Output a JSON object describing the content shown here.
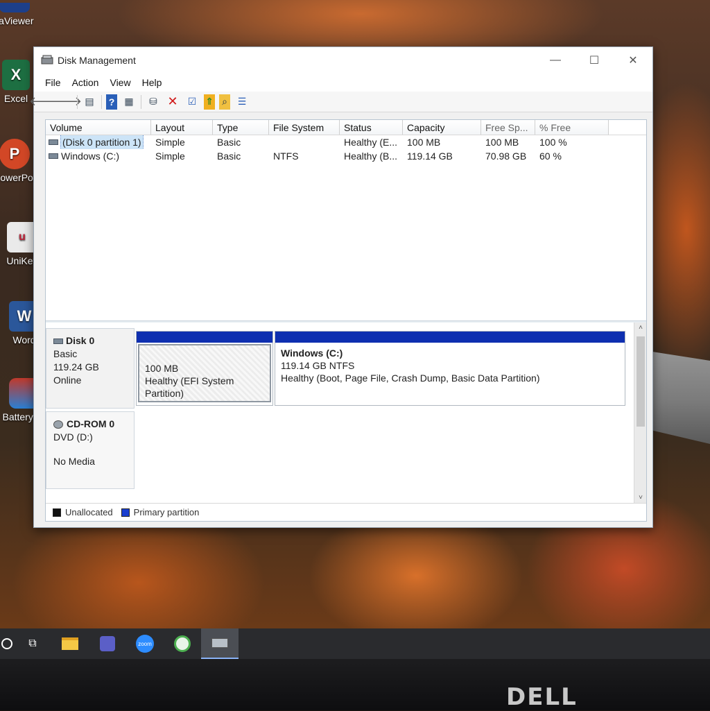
{
  "desktop": {
    "icons": [
      {
        "label": "raViewer",
        "icon": "ultraviewer-icon"
      },
      {
        "label": "Excel",
        "icon": "excel-icon",
        "letter": "X",
        "color": "#1d6f42"
      },
      {
        "label": "PowerPoi",
        "icon": "powerpoint-icon",
        "letter": "P",
        "color": "#d24726"
      },
      {
        "label": "UniKey",
        "icon": "unikey-icon",
        "letter": "u",
        "color": "#e8e8e8"
      },
      {
        "label": "Word",
        "icon": "word-icon",
        "letter": "W",
        "color": "#2b579a"
      },
      {
        "label": "BatteryMc",
        "icon": "batterymon-icon",
        "letter": "",
        "color": "#2a7fd4"
      }
    ]
  },
  "window": {
    "title": "Disk Management",
    "controls": {
      "minimize": "—",
      "maximize": "☐",
      "close": "✕"
    }
  },
  "menu": [
    "File",
    "Action",
    "View",
    "Help"
  ],
  "toolbar": [
    {
      "icon": "back-arrow-icon",
      "glyph": "🡐"
    },
    {
      "icon": "forward-arrow-icon",
      "glyph": "🡒"
    },
    {
      "icon": "console-tree-icon",
      "glyph": "▤"
    },
    {
      "icon": "help-icon",
      "glyph": "?"
    },
    {
      "icon": "properties-icon",
      "glyph": "▦"
    },
    {
      "icon": "connect-disk-icon",
      "glyph": "⛁"
    },
    {
      "icon": "delete-icon",
      "glyph": "✕"
    },
    {
      "icon": "check-icon",
      "glyph": "☑"
    },
    {
      "icon": "import-icon",
      "glyph": "⇑"
    },
    {
      "icon": "search-icon",
      "glyph": "⌕"
    },
    {
      "icon": "list-view-icon",
      "glyph": "☰"
    }
  ],
  "volume_list": {
    "columns": [
      "Volume",
      "Layout",
      "Type",
      "File System",
      "Status",
      "Capacity",
      "Free Sp...",
      "% Free"
    ],
    "rows": [
      {
        "volume": "(Disk 0 partition 1)",
        "layout": "Simple",
        "type": "Basic",
        "fs": "",
        "status": "Healthy (E...",
        "capacity": "100 MB",
        "free": "100 MB",
        "pct": "100 %"
      },
      {
        "volume": "Windows (C:)",
        "layout": "Simple",
        "type": "Basic",
        "fs": "NTFS",
        "status": "Healthy (B...",
        "capacity": "119.14 GB",
        "free": "70.98 GB",
        "pct": "60 %"
      }
    ]
  },
  "disks": [
    {
      "name": "Disk 0",
      "kind": "Basic",
      "size": "119.24 GB",
      "state": "Online",
      "partitions": [
        {
          "title": "",
          "size": "100 MB",
          "status": "Healthy (EFI System Partition)"
        },
        {
          "title": "Windows  (C:)",
          "size": "119.14 GB NTFS",
          "status": "Healthy (Boot, Page File, Crash Dump, Basic Data Partition)"
        }
      ]
    },
    {
      "name": "CD-ROM 0",
      "kind": "DVD (D:)",
      "state": "No Media"
    }
  ],
  "legend": [
    {
      "label": "Unallocated",
      "color": "#111111"
    },
    {
      "label": "Primary partition",
      "color": "#1a3fd0"
    }
  ],
  "taskbar": [
    {
      "icon": "search-circle-icon"
    },
    {
      "icon": "task-view-icon"
    },
    {
      "icon": "file-explorer-icon"
    },
    {
      "icon": "teams-icon"
    },
    {
      "icon": "zoom-icon",
      "label": "zoom"
    },
    {
      "icon": "green-app-icon"
    },
    {
      "icon": "disk-management-icon"
    }
  ],
  "brand": "DELL"
}
